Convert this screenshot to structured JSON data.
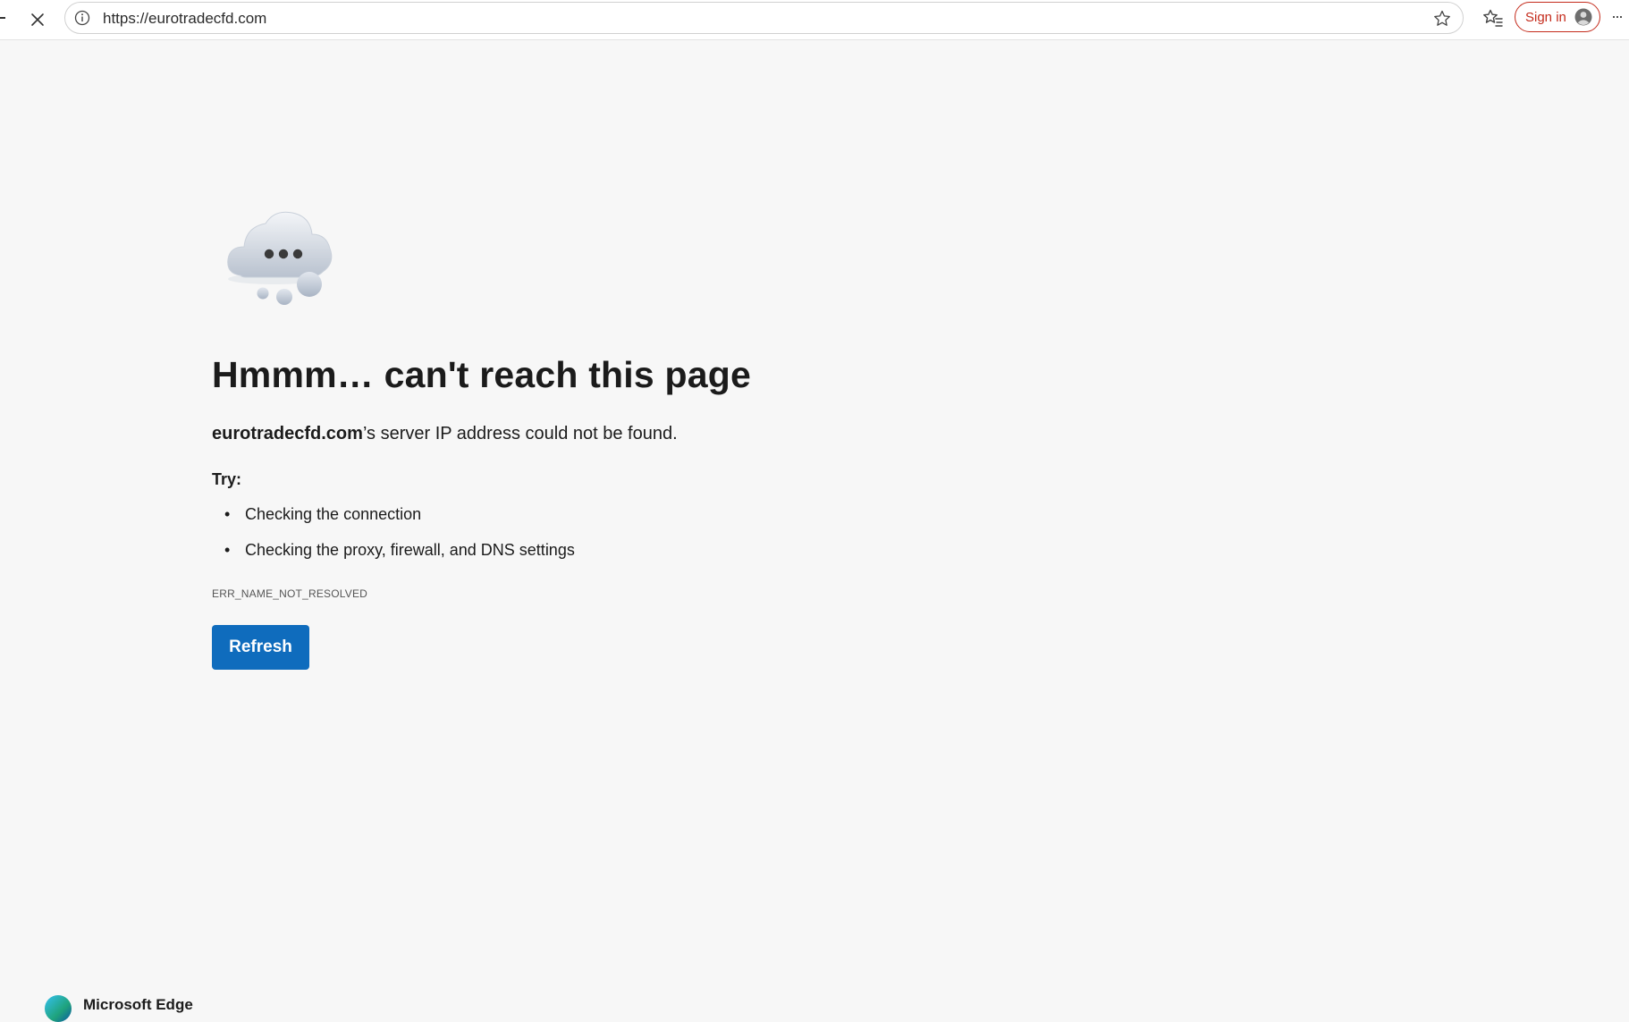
{
  "browser": {
    "url": "https://eurotradecfd.com",
    "signin_label": "Sign in",
    "more_label": "···",
    "icons": [
      "stop-icon",
      "info-icon",
      "star-icon",
      "favorites-icon",
      "avatar-icon",
      "more-icon"
    ]
  },
  "error_page": {
    "headline": "Hmmm… can't reach this page",
    "domain": "eurotradecfd.com",
    "message_suffix": "’s server IP address could not be found.",
    "try_label": "Try:",
    "suggestions": [
      "Checking the connection",
      "Checking the proxy, firewall, and DNS settings"
    ],
    "bullet": "•",
    "error_code": "ERR_NAME_NOT_RESOLVED",
    "refresh_label": "Refresh",
    "illustration": "cloud-icon"
  },
  "footer": {
    "brand": "Microsoft Edge"
  },
  "colors": {
    "accent": "#0f6cbd",
    "signin_border": "#c42b1c",
    "page_background": "#f7f7f7"
  }
}
